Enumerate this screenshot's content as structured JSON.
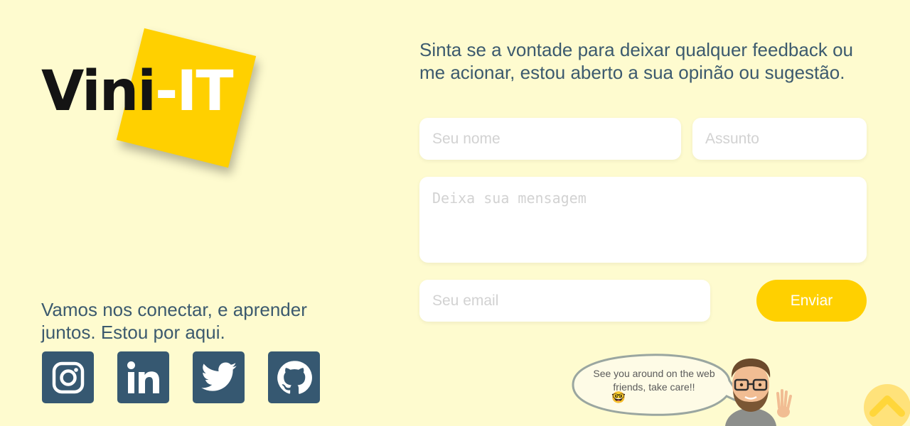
{
  "logo": {
    "part1": "Vini",
    "part2": "-IT",
    "accent_color": "#ffd000"
  },
  "left": {
    "connect_text": "Vamos nos conectar, e aprender juntos. Estou por aqui.",
    "social": [
      {
        "name": "instagram",
        "icon": "instagram-icon"
      },
      {
        "name": "linkedin",
        "icon": "linkedin-icon"
      },
      {
        "name": "twitter",
        "icon": "twitter-icon"
      },
      {
        "name": "github",
        "icon": "github-icon"
      }
    ],
    "social_color": "#365871"
  },
  "form": {
    "intro": "Sinta se a vontade para deixar qualquer feedback ou me acionar, estou aberto a sua opinão ou sugestão.",
    "name_placeholder": "Seu nome",
    "subject_placeholder": "Assunto",
    "message_placeholder": "Deixa sua mensagem",
    "email_placeholder": "Seu email",
    "submit_label": "Enviar"
  },
  "footer": {
    "bubble_text": "See you around  on the web friends, take care!!",
    "bubble_emoji": "🤓",
    "back_to_top_icon": "chevron-up-icon"
  },
  "colors": {
    "background": "#fefbcf",
    "text": "#3c5a6e",
    "accent": "#ffd000"
  }
}
